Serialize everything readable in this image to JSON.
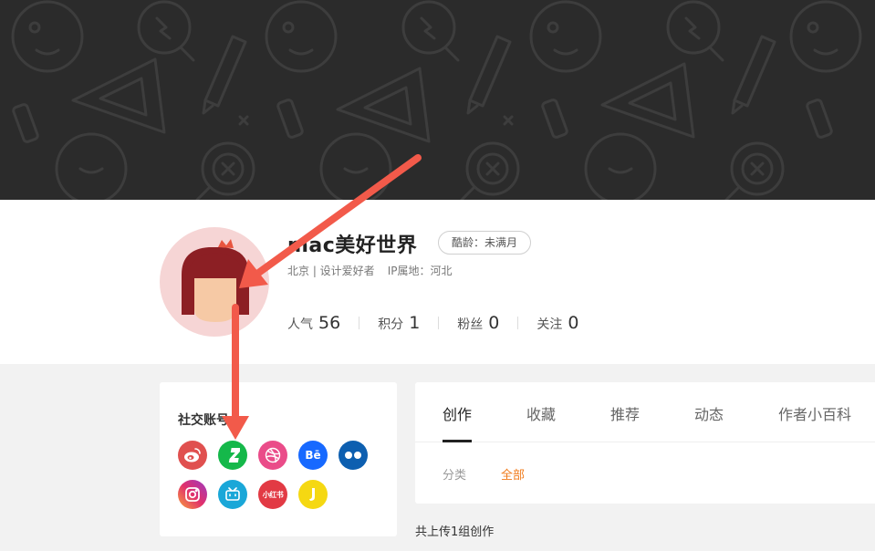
{
  "profile": {
    "username": "mac美好世界",
    "age_badge": "酷龄：未满月",
    "location_tag": "北京 | 设计爱好者",
    "ip_location": "IP属地：河北"
  },
  "stats": [
    {
      "label": "人气",
      "value": "56"
    },
    {
      "label": "积分",
      "value": "1"
    },
    {
      "label": "粉丝",
      "value": "0"
    },
    {
      "label": "关注",
      "value": "0"
    }
  ],
  "social": {
    "title": "社交账号",
    "icons": [
      {
        "name": "weibo-icon",
        "color": "#e0504f"
      },
      {
        "name": "deviantart-icon",
        "color": "#15b84a"
      },
      {
        "name": "dribbble-icon",
        "color": "#ea4c89"
      },
      {
        "name": "behance-icon",
        "color": "#1769ff",
        "text": "Bē"
      },
      {
        "name": "flickr-icon",
        "color": "#0d5fb0"
      },
      {
        "name": "instagram-icon",
        "color": "#d6337a"
      },
      {
        "name": "bilibili-icon",
        "color": "#1aa7d8"
      },
      {
        "name": "xiaohongshu-icon",
        "color": "#e23a44",
        "text": "小红书"
      },
      {
        "name": "zhihu-jike-icon",
        "color": "#f5d812"
      }
    ]
  },
  "tabs": [
    {
      "label": "创作",
      "active": true
    },
    {
      "label": "收藏"
    },
    {
      "label": "推荐"
    },
    {
      "label": "动态"
    },
    {
      "label": "作者小百科"
    }
  ],
  "filter": {
    "label": "分类",
    "all": "全部"
  },
  "upload_count": "共上传1组创作",
  "colors": {
    "banner_bg": "#2b2b2b",
    "accent_orange": "#f07a1a",
    "annotation_arrow": "#f25a4a",
    "avatar_bg": "#f6d5d5"
  }
}
